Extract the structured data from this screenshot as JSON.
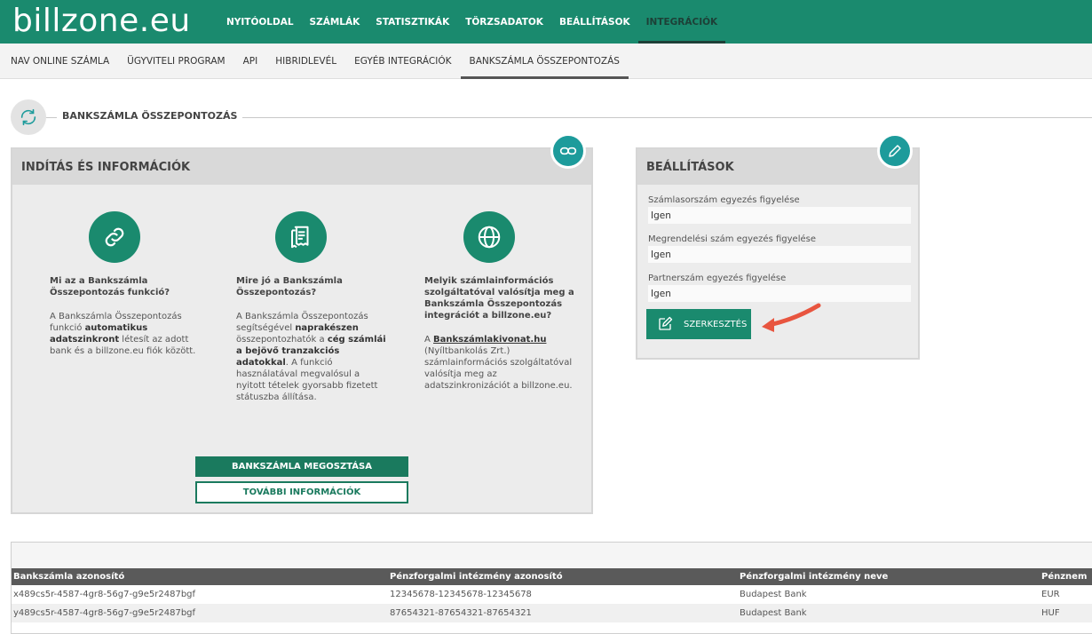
{
  "logo": {
    "text": "billzone.eu"
  },
  "main_nav": [
    {
      "label": "NYITÓOLDAL",
      "active": false
    },
    {
      "label": "SZÁMLÁK",
      "active": false
    },
    {
      "label": "STATISZTIKÁK",
      "active": false
    },
    {
      "label": "TÖRZSADATOK",
      "active": false
    },
    {
      "label": "BEÁLLÍTÁSOK",
      "active": false
    },
    {
      "label": "INTEGRÁCIÓK",
      "active": true
    }
  ],
  "sub_nav": [
    {
      "label": "NAV ONLINE SZÁMLA",
      "active": false
    },
    {
      "label": "ÜGYVITELI PROGRAM",
      "active": false
    },
    {
      "label": "API",
      "active": false
    },
    {
      "label": "HIBRIDLEVÉL",
      "active": false
    },
    {
      "label": "EGYÉB INTEGRÁCIÓK",
      "active": false
    },
    {
      "label": "BANKSZÁMLA ÖSSZEPONTOZÁS",
      "active": true
    }
  ],
  "section": {
    "title": "BANKSZÁMLA ÖSSZEPONTOZÁS",
    "icon": "sync-icon"
  },
  "info_panel": {
    "title": "INDÍTÁS ÉS INFORMÁCIÓK",
    "corner_icon": "link-icon",
    "columns": [
      {
        "icon": "link-icon",
        "heading": "Mi az a Bankszámla Összepontozás funkció?",
        "text_before": "A Bankszámla Összepontozás funkció ",
        "bold": "automatikus adatszinkront",
        "text_after": " létesít az adott bank és a billzone.eu fiók között."
      },
      {
        "icon": "receipts-icon",
        "heading": "Mire jó a Bankszámla Összepontozás?",
        "text_1": "A Bankszámla Összepontozás segítségével ",
        "bold_1": "naprakészen",
        "text_2": " összepontozhatók a ",
        "bold_2": "cég számlái a bejövő tranzakciós adatokkal",
        "text_3": ". A funkció használatával megvalósul a nyitott tételek gyorsabb fizetett státuszba állítása."
      },
      {
        "icon": "globe-icon",
        "heading": "Melyik számlainformációs szolgáltatóval valósítja meg a Bankszámla Összepontozás integrációt a billzone.eu?",
        "text_before": "A ",
        "link": "Bankszámlakivonat.hu",
        "text_after": " (Nyíltbankolás Zrt.) számlainformációs szolgáltatóval valósítja meg az adatszinkronizációt a billzone.eu."
      }
    ],
    "share_button": "BANKSZÁMLA MEGOSZTÁSA",
    "more_button": "TOVÁBBI INFORMÁCIÓK"
  },
  "settings_panel": {
    "title": "BEÁLLÍTÁSOK",
    "corner_icon": "pencil-icon",
    "fields": [
      {
        "label": "Számlasorszám egyezés figyelése",
        "value": "Igen"
      },
      {
        "label": "Megrendelési szám egyezés figyelése",
        "value": "Igen"
      },
      {
        "label": "Partnerszám egyezés figyelése",
        "value": "Igen"
      }
    ],
    "edit_button": "SZERKESZTÉS",
    "accent_color": "#1a8a6e",
    "arrow_color": "#e8553f"
  },
  "accounts_table": {
    "headers": [
      "Bankszámla azonosító",
      "Pénzforgalmi intézmény azonosító",
      "Pénzforgalmi intézmény neve",
      "Pénznem"
    ],
    "rows": [
      [
        "x489cs5r-4587-4gr8-56g7-g9e5r2487bgf",
        "12345678-12345678-12345678",
        "Budapest Bank",
        "EUR"
      ],
      [
        "y489cs5r-4587-4gr8-56g7-g9e5r2487bgf",
        "87654321-87654321-87654321",
        "Budapest Bank",
        "HUF"
      ]
    ]
  },
  "colors": {
    "brand": "#1a8a6e",
    "teal_icon": "#1d9b9b",
    "nav_active": "#1d4037"
  }
}
